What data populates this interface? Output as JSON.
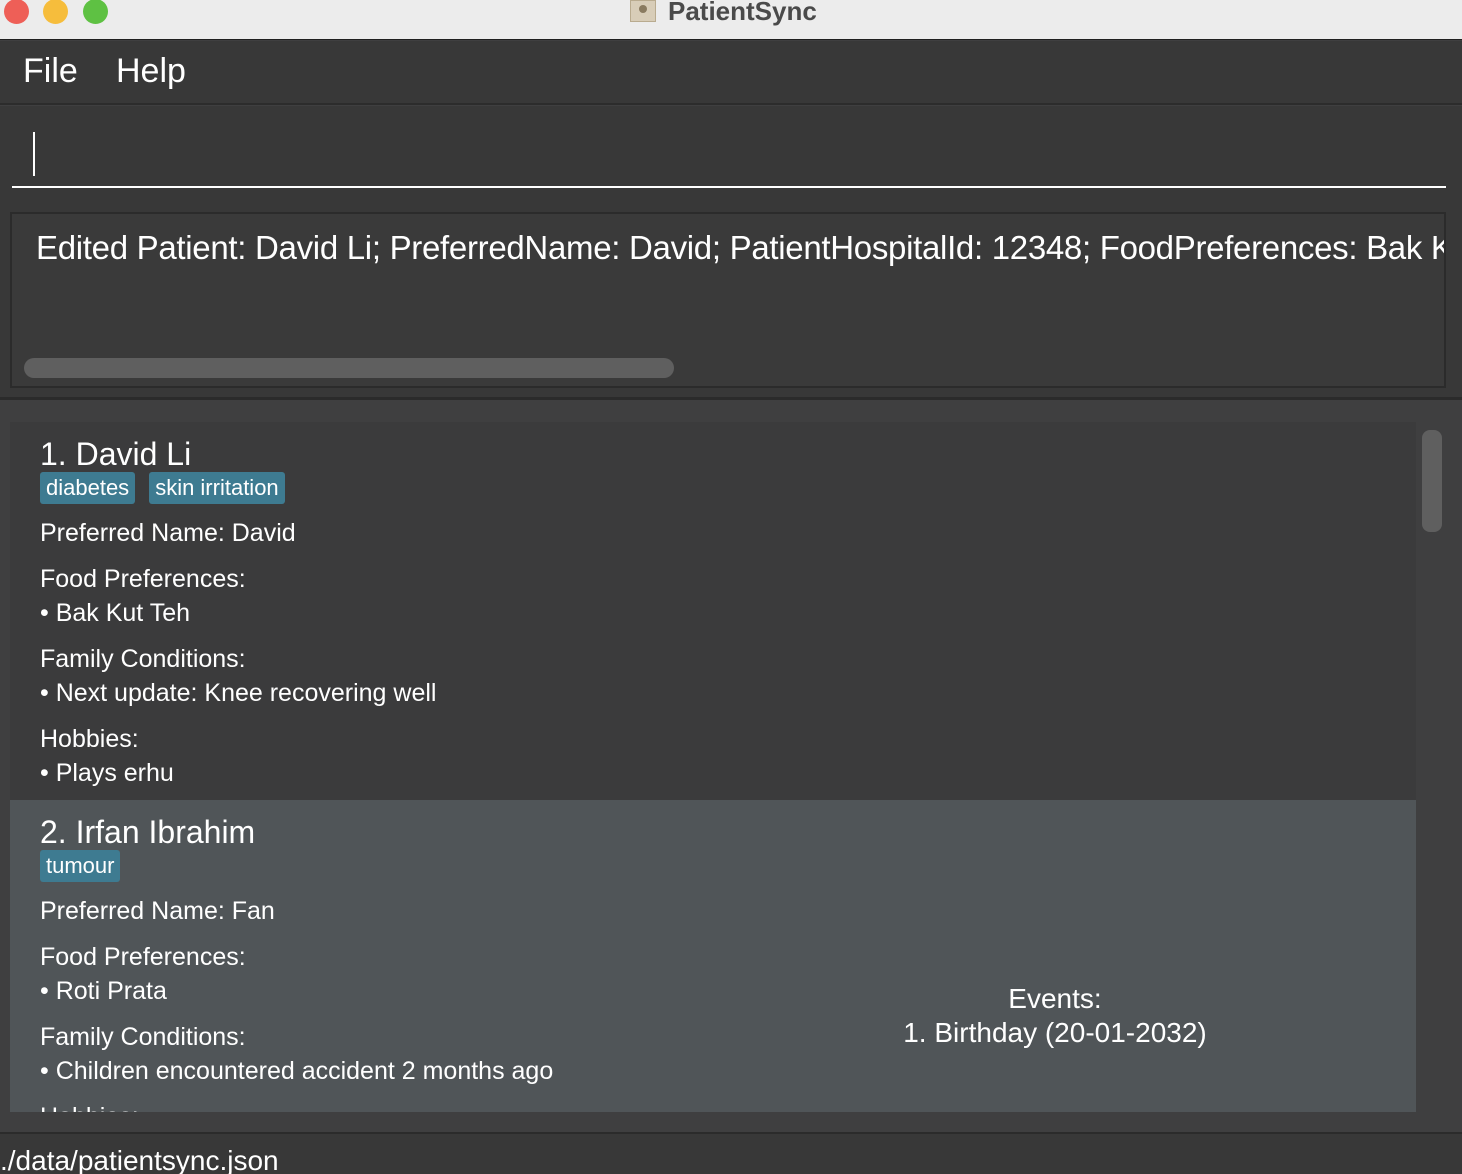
{
  "window": {
    "title": "PatientSync"
  },
  "menu": {
    "file": "File",
    "help": "Help"
  },
  "command": {
    "value": "",
    "placeholder": ""
  },
  "result": {
    "text": "Edited Patient: David Li; PreferredName: David; PatientHospitalId: 12348; FoodPreferences: Bak Ku"
  },
  "patients": [
    {
      "name": "1.  David Li",
      "tags": [
        "diabetes",
        "skin irritation"
      ],
      "preferred_name": "Preferred Name:  David",
      "food_label": "Food Preferences:",
      "food_items": [
        "• Bak Kut Teh"
      ],
      "family_label": "Family Conditions:",
      "family_items": [
        "• Next update: Knee recovering well"
      ],
      "hobbies_label": "Hobbies:",
      "hobbies_items": [
        "• Plays erhu"
      ]
    },
    {
      "name": "2.  Irfan Ibrahim",
      "tags": [
        "tumour"
      ],
      "preferred_name": "Preferred Name:  Fan",
      "food_label": "Food Preferences:",
      "food_items": [
        "• Roti Prata"
      ],
      "family_label": "Family Conditions:",
      "family_items": [
        "• Children encountered accident 2 months ago"
      ],
      "hobbies_label": "Hobbies:",
      "events_label": "Events:",
      "events_items": [
        "1. Birthday (20-01-2032)"
      ]
    }
  ],
  "status": {
    "path": "./data/patientsync.json"
  }
}
